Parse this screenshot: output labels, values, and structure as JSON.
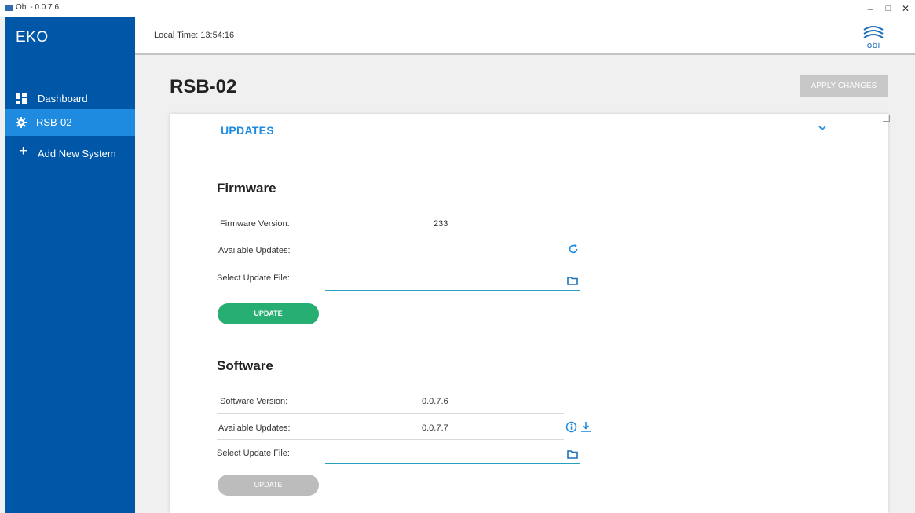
{
  "window": {
    "title": "Obi - 0.0.7.6"
  },
  "sidebar": {
    "brand": "EKO",
    "items": [
      {
        "label": "Dashboard",
        "icon": "dashboard-icon"
      },
      {
        "label": "RSB-02",
        "icon": "gear-icon",
        "active": true
      },
      {
        "label": "Add New System",
        "icon": "plus-icon"
      }
    ]
  },
  "header": {
    "local_time": "Local Time: 13:54:16",
    "logo_text": "obi"
  },
  "page": {
    "title": "RSB-02",
    "apply_label": "APPLY CHANGES"
  },
  "updates": {
    "section_title": "UPDATES",
    "firmware": {
      "heading": "Firmware",
      "version_label": "Firmware Version:",
      "version_value": "233",
      "available_label": "Available Updates:",
      "available_value": "",
      "file_label": "Select Update File:",
      "update_label": "UPDATE"
    },
    "software": {
      "heading": "Software",
      "version_label": "Software Version:",
      "version_value": "0.0.7.6",
      "available_label": "Available Updates:",
      "available_value": "0.0.7.7",
      "file_label": "Select Update File:",
      "update_label": "UPDATE"
    }
  },
  "colors": {
    "sidebar": "#0057a8",
    "accent": "#1e8be0",
    "update_active": "#27ae73",
    "update_disabled": "#bcbcbc"
  }
}
